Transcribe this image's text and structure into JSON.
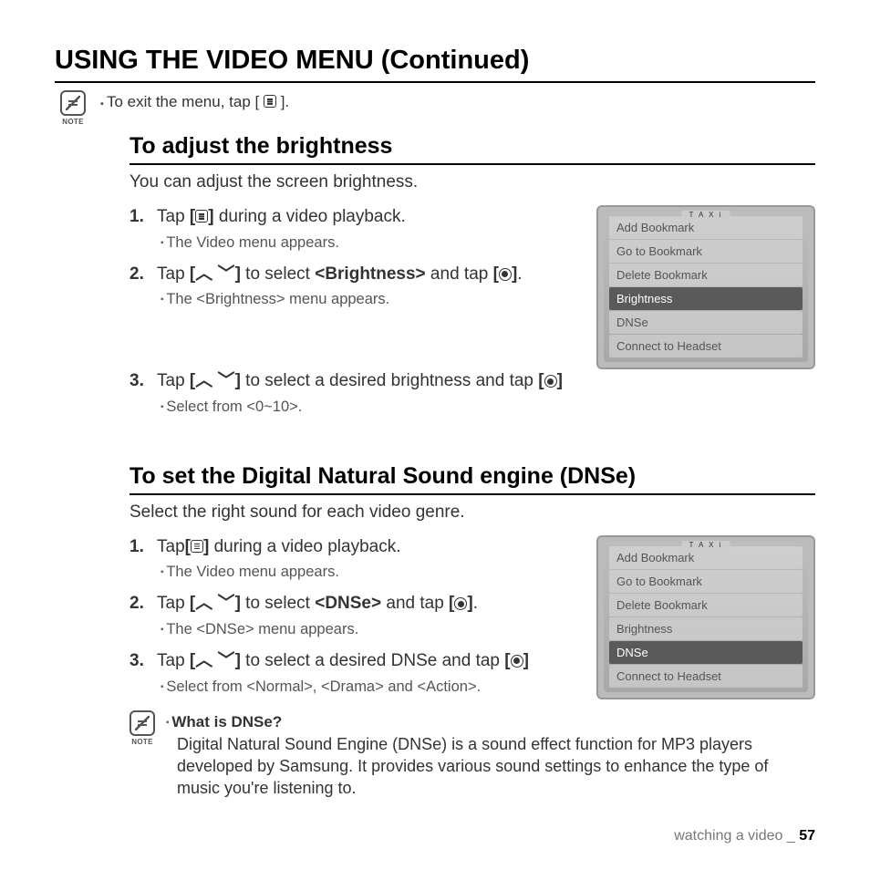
{
  "page_title": "USING THE VIDEO MENU (Continued)",
  "note_label": "NOTE",
  "exit_text_pre": "To exit the menu, tap [",
  "exit_text_post": "].",
  "sections": {
    "brightness": {
      "title": "To adjust the brightness",
      "intro": "You can adjust the screen brightness.",
      "steps": [
        {
          "n": "1.",
          "pre": "Tap ",
          "mid": " during a video playback.",
          "sub": "The Video menu appears."
        },
        {
          "n": "2.",
          "pre": "Tap ",
          "mid": " to select ",
          "target": "<Brightness>",
          "mid2": " and tap ",
          "post": ".",
          "sub": "The <Brightness> menu appears."
        },
        {
          "n": "3.",
          "pre": "Tap ",
          "mid": " to select a desired brightness and tap ",
          "post": "",
          "sub": "Select from <0~10>."
        }
      ],
      "menu": [
        "Add Bookmark",
        "Go to Bookmark",
        "Delete Bookmark",
        "Brightness",
        "DNSe",
        "Connect to Headset"
      ],
      "selected": "Brightness"
    },
    "dnse": {
      "title": "To set the Digital Natural Sound engine (DNSe)",
      "intro": "Select the right sound for each video genre.",
      "steps": [
        {
          "n": "1.",
          "pre": "Tap",
          "mid": " during a video playback.",
          "sub": "The Video menu appears."
        },
        {
          "n": "2.",
          "pre": "Tap ",
          "mid": " to select ",
          "target": "<DNSe>",
          "mid2": " and tap ",
          "post": ".",
          "sub": "The <DNSe> menu appears."
        },
        {
          "n": "3.",
          "pre": "Tap ",
          "mid": " to select a desired DNSe and tap ",
          "post": "",
          "sub": "Select from <Normal>, <Drama> and <Action>."
        }
      ],
      "menu": [
        "Add Bookmark",
        "Go to Bookmark",
        "Delete Bookmark",
        "Brightness",
        "DNSe",
        "Connect to Headset"
      ],
      "selected": "DNSe"
    }
  },
  "dnse_note": {
    "q": "What is DNSe?",
    "a": "Digital Natural Sound Engine (DNSe) is a sound effect function for MP3 players developed by Samsung. It provides various sound settings to enhance the type of music you're listening to."
  },
  "footer": {
    "section": "watching a video _ ",
    "page": "57"
  },
  "taxi": "T A X i"
}
